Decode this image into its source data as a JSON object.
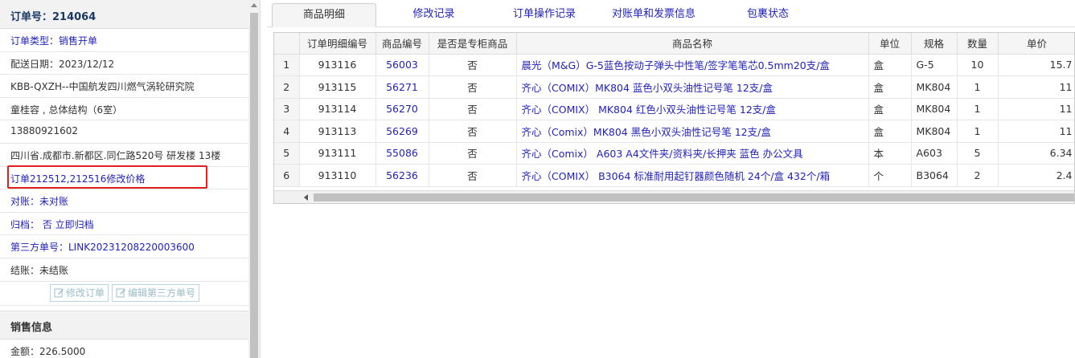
{
  "order": {
    "title": "订单号：214064",
    "rows": [
      {
        "text": "订单类型：销售开单",
        "style": "link"
      },
      {
        "text": "配送日期：2023/12/12",
        "style": "plain"
      },
      {
        "text": "KBB-QXZH--中国航发四川燃气涡轮研究院",
        "style": "plain"
      },
      {
        "text": "童桂容 , 总体结构（6室）",
        "style": "plain"
      },
      {
        "text": "13880921602",
        "style": "plain"
      },
      {
        "text": "四川省.成都市.新都区.同仁路520号 研发楼 13楼",
        "style": "plain"
      },
      {
        "text": "订单212512,212516修改价格",
        "style": "link"
      },
      {
        "text": "对账：未对账",
        "style": "link"
      },
      {
        "text": "归档： 否 立即归档",
        "style": "link"
      },
      {
        "text": "第三方单号：LINK20231208220003600",
        "style": "link"
      },
      {
        "text": "结账：未结账",
        "style": "plain"
      }
    ],
    "edit_order_label": "修改订单",
    "edit_third_party_label": "编辑第三方单号",
    "sales_section_title": "销售信息",
    "amount_text": "金额：226.5000"
  },
  "tabs": [
    {
      "label": "商品明细",
      "active": true
    },
    {
      "label": "修改记录",
      "active": false
    },
    {
      "label": "订单操作记录",
      "active": false
    },
    {
      "label": "对账单和发票信息",
      "active": false
    },
    {
      "label": "包裹状态",
      "active": false
    }
  ],
  "table": {
    "columns": [
      "",
      "订单明细编号",
      "商品编号",
      "是否是专柜商品",
      "商品名称",
      "单位",
      "规格",
      "数量",
      "单价"
    ],
    "rows": [
      [
        "1",
        "913116",
        "56003",
        "否",
        "晨光（M&G）G-5蓝色按动子弹头中性笔/签字笔笔芯0.5mm20支/盒",
        "盒",
        "G-5",
        "10",
        "15.7"
      ],
      [
        "2",
        "913115",
        "56271",
        "否",
        "齐心（COMIX）MK804 蓝色小双头油性记号笔 12支/盒",
        "盒",
        "MK804",
        "1",
        "11"
      ],
      [
        "3",
        "913114",
        "56270",
        "否",
        "齐心（COMIX） MK804 红色小双头油性记号笔 12支/盒",
        "盒",
        "MK804",
        "1",
        "11"
      ],
      [
        "4",
        "913113",
        "56269",
        "否",
        "齐心（Comix）MK804 黑色小双头油性记号笔 12支/盒",
        "盒",
        "MK804",
        "1",
        "11"
      ],
      [
        "5",
        "913111",
        "55086",
        "否",
        "齐心（Comix） A603 A4文件夹/资料夹/长押夹 蓝色 办公文具",
        "本",
        "A603",
        "5",
        "6.34"
      ],
      [
        "6",
        "913110",
        "56236",
        "否",
        "齐心（COMIX） B3064 标准耐用起钉器颜色随机 24个/盒 432个/箱",
        "个",
        "B3064",
        "2",
        "2.4"
      ]
    ]
  }
}
